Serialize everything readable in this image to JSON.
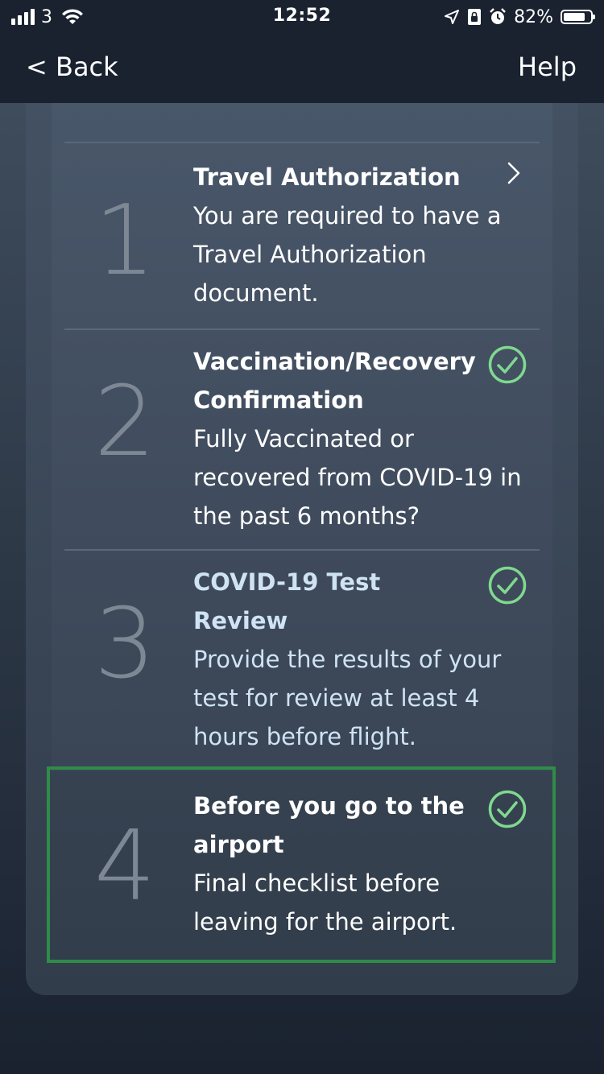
{
  "status_bar": {
    "carrier": "3",
    "time": "12:52",
    "battery_percent": "82%",
    "battery_level": 0.82
  },
  "nav": {
    "back_label": "< Back",
    "help_label": "Help"
  },
  "steps": [
    {
      "number": "1",
      "title": "Travel Authorization",
      "description_lines": [
        "You are required to have a",
        "Travel Authorization",
        "document."
      ],
      "status": "navigate"
    },
    {
      "number": "2",
      "title_lines": [
        "Vaccination/Recovery",
        "Confirmation"
      ],
      "description_lines": [
        "Fully Vaccinated or",
        "recovered from COVID-19 in",
        "the past 6 months?"
      ],
      "status": "complete"
    },
    {
      "number": "3",
      "title_lines": [
        "COVID-19 Test",
        "Review"
      ],
      "description_lines": [
        "Provide the results of your",
        "test for review at least 4",
        "hours before flight."
      ],
      "status": "complete"
    },
    {
      "number": "4",
      "title_lines": [
        "Before you go to the",
        "airport"
      ],
      "description_lines": [
        "Final checklist before",
        "leaving for the airport."
      ],
      "status": "complete"
    }
  ],
  "colors": {
    "check_green": "#7fd98f",
    "highlight_green": "#2f8c49",
    "link_blue": "#cfe3f5"
  }
}
